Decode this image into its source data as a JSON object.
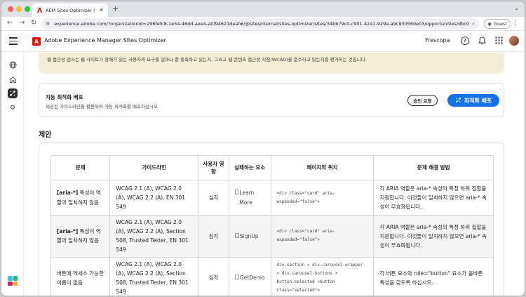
{
  "browser": {
    "tab_title": "AEM Sites Optimizer | Adobe",
    "url": "experience.adobe.com/?organizationId=296fefc8-1e54-46dd-aee4-a0f94621deaf#/@sitesinternal/sites-optimizer/sites/34bb79c0-c901-4241-929e-a9c930560e03/opportunities/dbc0589...",
    "guest_label": "Guest"
  },
  "app": {
    "title": "Adobe Experience Manager Sites Optimizer",
    "org": "Frescopa"
  },
  "banner": {
    "text": "웹 접근성 검사는 웹 사이트가 장애가 있는 사용자의 요구를 얼마나 잘 충족하고 있는지, 그리고 웹 콘텐츠 접근성 지침(WCAG)을 준수하고 있는지를 평가하는 것입니다."
  },
  "deploy": {
    "title": "자동 최적화 배포",
    "subtitle": "제공된 가이드라인을 활용하여 자동 최적화를 배포하십시오.",
    "approve_label": "승인 요청",
    "optimize_label": "최적화 배포"
  },
  "suggestions": {
    "title": "제안",
    "headers": {
      "issue": "문제",
      "guideline": "가이드라인",
      "impact": "사용자 영향",
      "element": "실패하는 요소",
      "location": "페이지의 위치",
      "fix": "문제 해결 방법"
    },
    "rows": [
      {
        "issue_code": "[aria-*]",
        "issue_text": " 특성이 역할과 일치하지 않음",
        "guideline": "WCAG 2.1 (A), WCAG 2.0 (A), WCAG 2.2 (A), EN 301 549",
        "impact": "심각",
        "element": "Learn More",
        "location": "<div class=\"card\" aria-expanded=\"false\">",
        "fix": "각 ARIA 역할은 aria-* 속성의 특정 하위 집합을 지원합니다. 이것들이 일치하지 않으면 aria-* 속성이 무효화됩니다."
      },
      {
        "issue_code": "[aria-*]",
        "issue_text": " 특성이 역할과 일치하지 않음",
        "guideline": "WCAG 2.1 (A), WCAG 2.0 (A), WCAG 2.2 (A), Section 508, Trusted Tester, EN 301 549",
        "impact": "심각",
        "element": "SignUp",
        "location": "<div class=\"card\" aria-expanded=\"false\">",
        "fix": "각 ARIA 역할은 aria-* 속성의 특정 하위 집합을 지원합니다. 이것들이 일치하지 않으면 aria-* 속성이 무효화됩니다."
      },
      {
        "issue_code": "",
        "issue_text": "버튼에 액세스 가능한 이름이 없음",
        "guideline": "WCAG 2.1 (A), WCAG 2.0 (A), WCAG 2.2 (A), Section 508, Trusted Tester, EN 301 549",
        "impact": "심각",
        "element": "GetDemo",
        "location": "div.section > div.carousel-wrapper > div.carousel-buttons > button.selected <button class=\"selected\">",
        "fix": "각 버튼 요소와 role=\"button\" 요소가 올바른 특성을 갖도록 하십시오."
      }
    ]
  },
  "colors": {
    "accent": "#1473e6",
    "banner_bg": "#f4eed7",
    "adobe_red": "#eb1000"
  }
}
